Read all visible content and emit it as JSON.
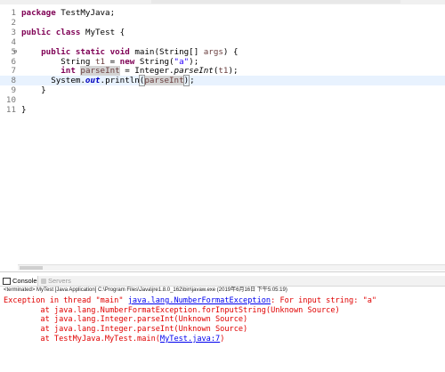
{
  "editor": {
    "lines": [
      {
        "n": "1",
        "marker": "",
        "parts": [
          [
            "kw",
            "package"
          ],
          [
            "",
            " TestMyJava;"
          ]
        ]
      },
      {
        "n": "2",
        "marker": "",
        "parts": []
      },
      {
        "n": "3",
        "marker": "",
        "parts": [
          [
            "kw",
            "public"
          ],
          [
            "",
            " "
          ],
          [
            "kw",
            "class"
          ],
          [
            "",
            " MyTest {"
          ]
        ]
      },
      {
        "n": "4",
        "marker": "",
        "parts": []
      },
      {
        "n": "5",
        "marker": "⊖",
        "parts": [
          [
            "",
            "    "
          ],
          [
            "kw",
            "public"
          ],
          [
            "",
            " "
          ],
          [
            "kw",
            "static"
          ],
          [
            "",
            " "
          ],
          [
            "kw",
            "void"
          ],
          [
            "",
            " main(String[] "
          ],
          [
            "param",
            "args"
          ],
          [
            "",
            ") {"
          ]
        ]
      },
      {
        "n": "6",
        "marker": "",
        "parts": [
          [
            "",
            "        String "
          ],
          [
            "var",
            "t1"
          ],
          [
            "",
            " = "
          ],
          [
            "kw",
            "new"
          ],
          [
            "",
            " String("
          ],
          [
            "str",
            "\"a\""
          ],
          [
            "",
            ");"
          ]
        ]
      },
      {
        "n": "7",
        "marker": "",
        "parts": [
          [
            "",
            "        "
          ],
          [
            "kw",
            "int"
          ],
          [
            "",
            " "
          ],
          [
            "var occ",
            "parseInt"
          ],
          [
            "",
            " = Integer."
          ],
          [
            "static-method",
            "parseInt"
          ],
          [
            "",
            "("
          ],
          [
            "var",
            "t1"
          ],
          [
            "",
            ");"
          ]
        ]
      },
      {
        "n": "8",
        "marker": "",
        "highlight": true,
        "parts": [
          [
            "",
            "      System."
          ],
          [
            "static-field",
            "out"
          ],
          [
            "",
            ".println"
          ],
          [
            "bracket",
            "("
          ],
          [
            "var occ",
            "parseInt"
          ],
          [
            "bracket",
            ")"
          ],
          [
            "cursor",
            ""
          ],
          [
            "",
            ";"
          ]
        ]
      },
      {
        "n": "9",
        "marker": "",
        "parts": [
          [
            "",
            "    }"
          ]
        ]
      },
      {
        "n": "10",
        "marker": "",
        "parts": []
      },
      {
        "n": "11",
        "marker": "",
        "parts": [
          [
            "",
            "}"
          ]
        ]
      }
    ]
  },
  "console": {
    "tab_console": "Console",
    "tab_servers": "Servers",
    "terminated": "<terminated> MyTest [Java Application] C:\\Program Files\\Java\\jre1.8.0_162\\bin\\javaw.exe (2019年6月16日 下午5:05:19)",
    "lines": [
      [
        [
          "",
          "Exception in thread \"main\" "
        ],
        [
          "link",
          "java.lang.NumberFormatException"
        ],
        [
          "",
          ": For input string: \"a\""
        ]
      ],
      [
        [
          "",
          "\tat java.lang.NumberFormatException.forInputString(Unknown Source)"
        ]
      ],
      [
        [
          "",
          "\tat java.lang.Integer.parseInt(Unknown Source)"
        ]
      ],
      [
        [
          "",
          "\tat java.lang.Integer.parseInt(Unknown Source)"
        ]
      ],
      [
        [
          "",
          "\tat TestMyJava.MyTest.main("
        ],
        [
          "link",
          "MyTest.java:7"
        ],
        [
          "",
          ")"
        ]
      ]
    ]
  },
  "colors": {
    "keyword": "#7f0055",
    "string": "#2a00ff",
    "error": "#e00000",
    "link": "#0000ee",
    "current_line": "#e8f2fe"
  }
}
